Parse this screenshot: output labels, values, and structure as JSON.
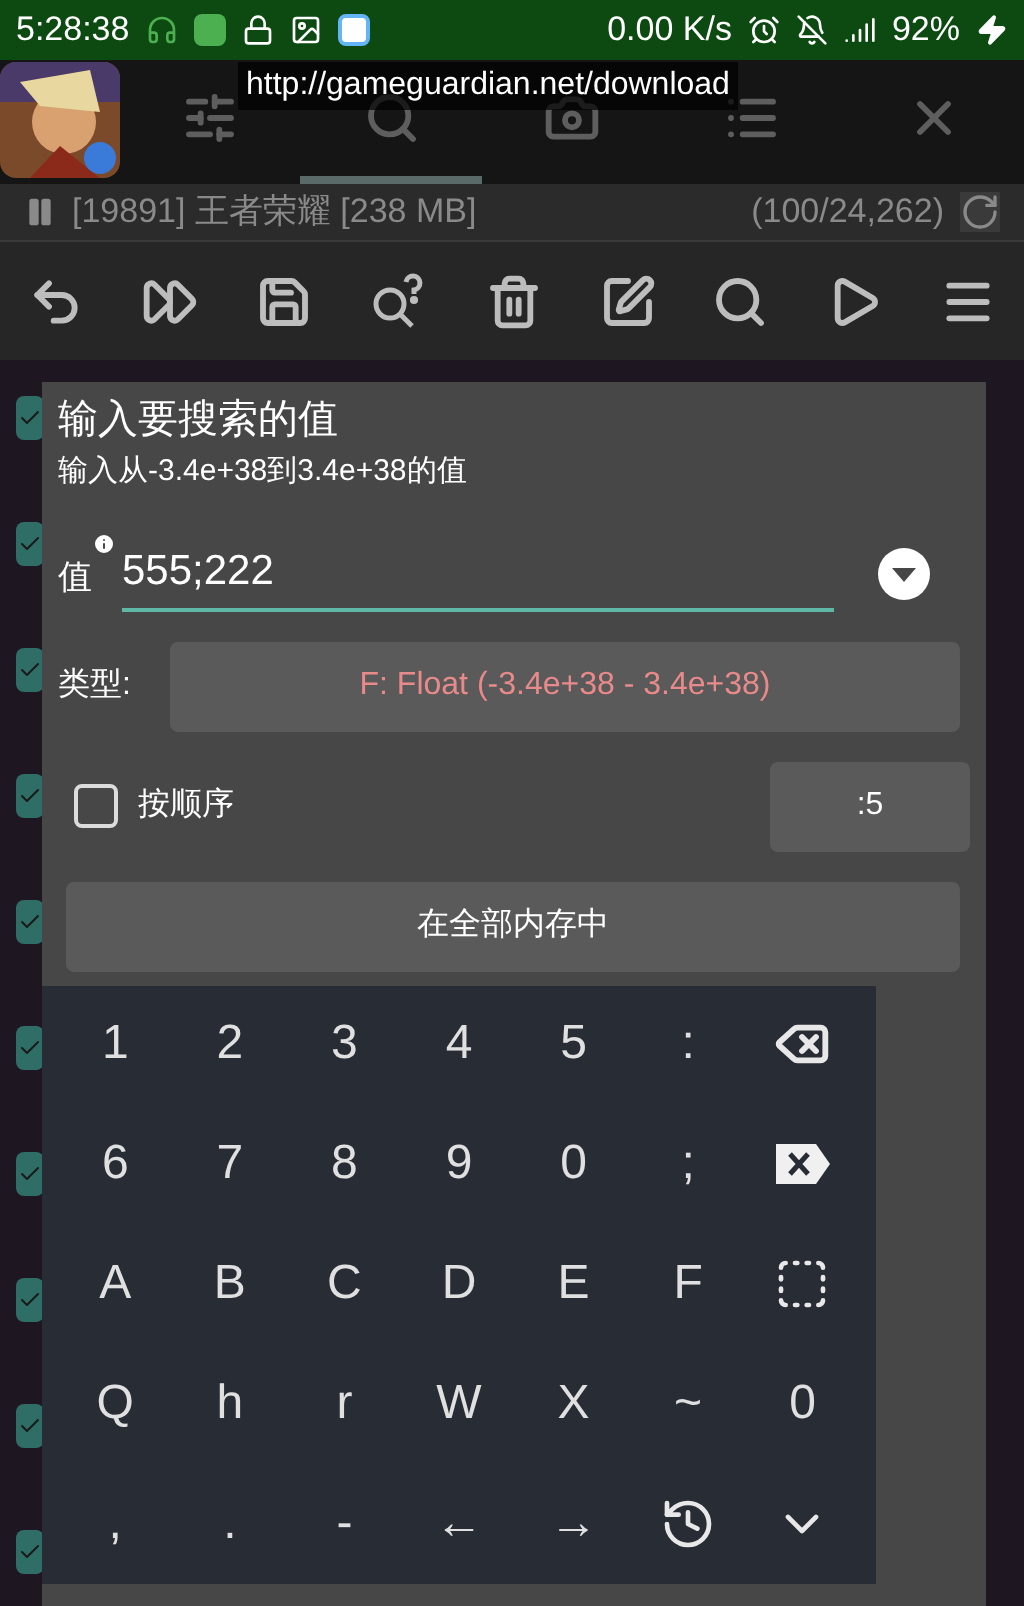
{
  "status_bar": {
    "time": "5:28:38",
    "speed": "0.00 K/s",
    "battery": "92%"
  },
  "overlay_url": "http://gameguardian.net/download",
  "tabs": [
    {
      "kind": "settings",
      "selected": false
    },
    {
      "kind": "search",
      "selected": true
    },
    {
      "kind": "camera",
      "selected": false
    },
    {
      "kind": "list",
      "selected": false
    },
    {
      "kind": "close",
      "selected": false
    }
  ],
  "process": {
    "label": "[19891] 王者荣耀 [238 MB]",
    "count": "(100/24,262)"
  },
  "toolbar": [
    {
      "kind": "undo"
    },
    {
      "kind": "forward"
    },
    {
      "kind": "save"
    },
    {
      "kind": "search-question"
    },
    {
      "kind": "trash"
    },
    {
      "kind": "edit"
    },
    {
      "kind": "search"
    },
    {
      "kind": "play"
    },
    {
      "kind": "menu"
    }
  ],
  "background_checks": [
    {
      "checked": true
    },
    {
      "checked": true
    },
    {
      "checked": true
    },
    {
      "checked": true
    },
    {
      "checked": true
    },
    {
      "checked": true
    },
    {
      "checked": true
    },
    {
      "checked": true
    },
    {
      "checked": true
    },
    {
      "checked": true
    }
  ],
  "dialog": {
    "title": "输入要搜索的值",
    "subtitle": "输入从-3.4e+38到3.4e+38的值",
    "value_label": "值",
    "value": "555;222",
    "type_label": "类型:",
    "type_value": "F: Float (-3.4e+38 - 3.4e+38)",
    "ordered": {
      "label": "按顺序",
      "checked": false
    },
    "step": ":5",
    "region": "在全部内存中"
  },
  "keyboard": [
    [
      {
        "kind": "char",
        "label": "1"
      },
      {
        "kind": "char",
        "label": "2"
      },
      {
        "kind": "char",
        "label": "3"
      },
      {
        "kind": "char",
        "label": "4"
      },
      {
        "kind": "char",
        "label": "5"
      },
      {
        "kind": "char",
        "label": ":"
      },
      {
        "kind": "backspace"
      }
    ],
    [
      {
        "kind": "char",
        "label": "6"
      },
      {
        "kind": "char",
        "label": "7"
      },
      {
        "kind": "char",
        "label": "8"
      },
      {
        "kind": "char",
        "label": "9"
      },
      {
        "kind": "char",
        "label": "0"
      },
      {
        "kind": "char",
        "label": ";"
      },
      {
        "kind": "delete"
      }
    ],
    [
      {
        "kind": "char",
        "label": "A"
      },
      {
        "kind": "char",
        "label": "B"
      },
      {
        "kind": "char",
        "label": "C"
      },
      {
        "kind": "char",
        "label": "D"
      },
      {
        "kind": "char",
        "label": "E"
      },
      {
        "kind": "char",
        "label": "F"
      },
      {
        "kind": "select-all"
      }
    ],
    [
      {
        "kind": "char",
        "label": "Q"
      },
      {
        "kind": "char",
        "label": "h"
      },
      {
        "kind": "char",
        "label": "r"
      },
      {
        "kind": "char",
        "label": "W"
      },
      {
        "kind": "char",
        "label": "X"
      },
      {
        "kind": "char",
        "label": "~"
      },
      {
        "kind": "char",
        "label": "0"
      }
    ],
    [
      {
        "kind": "char",
        "label": ","
      },
      {
        "kind": "char",
        "label": "."
      },
      {
        "kind": "char",
        "label": "-"
      },
      {
        "kind": "char",
        "label": "←"
      },
      {
        "kind": "char",
        "label": "→"
      },
      {
        "kind": "history"
      },
      {
        "kind": "hide"
      }
    ]
  ]
}
